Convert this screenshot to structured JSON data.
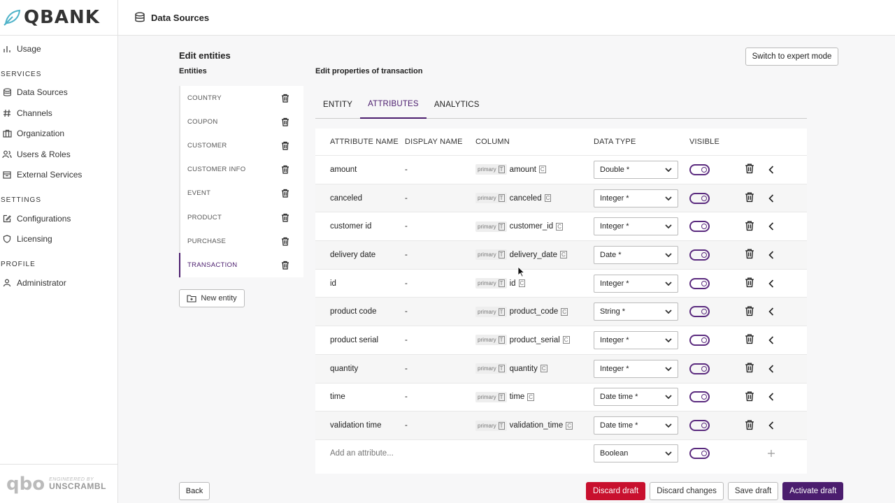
{
  "app": {
    "logo_text": "QBANK",
    "topbar_title": "Data Sources"
  },
  "sidebar": {
    "items_top": [
      {
        "label": "Usage",
        "icon": "bar-chart-icon"
      }
    ],
    "sections": [
      {
        "title": "SERVICES",
        "items": [
          {
            "label": "Data Sources",
            "icon": "database-icon"
          },
          {
            "label": "Channels",
            "icon": "hash-icon"
          },
          {
            "label": "Organization",
            "icon": "briefcase-icon"
          },
          {
            "label": "Users & Roles",
            "icon": "users-icon"
          },
          {
            "label": "External Services",
            "icon": "calendar-icon"
          }
        ]
      },
      {
        "title": "SETTINGS",
        "items": [
          {
            "label": "Configurations",
            "icon": "edit-icon"
          },
          {
            "label": "Licensing",
            "icon": "shield-icon"
          }
        ]
      },
      {
        "title": "PROFILE",
        "items": [
          {
            "label": "Administrator",
            "icon": "user-icon"
          }
        ]
      }
    ],
    "footer": {
      "logo": "qbo",
      "engineered": "ENGINEERED BY",
      "brand": "UNSCRAMBL"
    }
  },
  "main": {
    "page_title": "Edit entities",
    "entities_label": "Entities",
    "entities": [
      "COUNTRY",
      "COUPON",
      "CUSTOMER",
      "CUSTOMER INFO",
      "EVENT",
      "PRODUCT",
      "PURCHASE",
      "TRANSACTION"
    ],
    "active_entity": "TRANSACTION",
    "new_entity_label": "New entity",
    "back_label": "Back",
    "edit_props_label": "Edit properties of transaction",
    "expert_mode_label": "Switch to expert mode",
    "tabs": [
      "ENTITY",
      "ATTRIBUTES",
      "ANALYTICS"
    ],
    "active_tab": "ATTRIBUTES",
    "table": {
      "headers": {
        "name": "ATTRIBUTE NAME",
        "display": "DISPLAY NAME",
        "column": "COLUMN",
        "type": "DATA TYPE",
        "visible": "VISIBLE"
      },
      "primary_tag": "primary",
      "type_letter": "T",
      "col_letter": "C",
      "rows": [
        {
          "name": "amount",
          "display": "-",
          "column": "amount",
          "type": "Double *"
        },
        {
          "name": "canceled",
          "display": "-",
          "column": "canceled",
          "type": "Integer *"
        },
        {
          "name": "customer id",
          "display": "-",
          "column": "customer_id",
          "type": "Integer *"
        },
        {
          "name": "delivery date",
          "display": "-",
          "column": "delivery_date",
          "type": "Date *"
        },
        {
          "name": "id",
          "display": "-",
          "column": "id",
          "type": "Integer *"
        },
        {
          "name": "product code",
          "display": "-",
          "column": "product_code",
          "type": "String *"
        },
        {
          "name": "product serial",
          "display": "-",
          "column": "product_serial",
          "type": "Integer *"
        },
        {
          "name": "quantity",
          "display": "-",
          "column": "quantity",
          "type": "Integer *"
        },
        {
          "name": "time",
          "display": "-",
          "column": "time",
          "type": "Date time *"
        },
        {
          "name": "validation time",
          "display": "-",
          "column": "validation_time",
          "type": "Date time *"
        }
      ],
      "add_placeholder": "Add an attribute...",
      "add_type": "Boolean"
    },
    "buttons": {
      "discard_draft": "Discard draft",
      "discard_changes": "Discard changes",
      "save_draft": "Save draft",
      "activate_draft": "Activate draft"
    }
  },
  "colors": {
    "accent": "#4b1d6e",
    "danger": "#c8102e"
  }
}
